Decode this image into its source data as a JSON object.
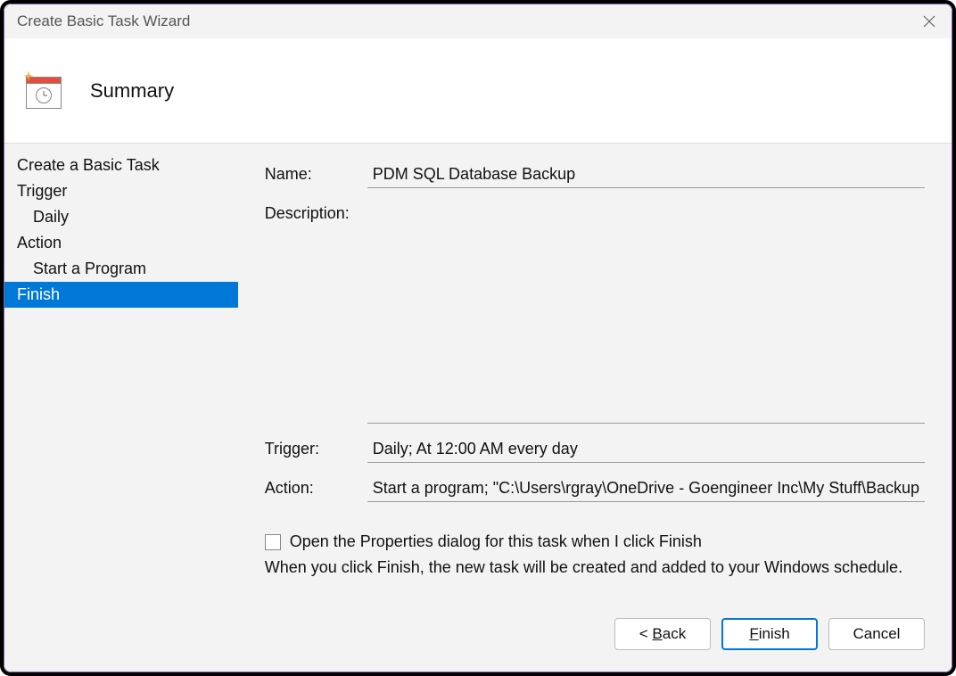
{
  "window": {
    "title": "Create Basic Task Wizard"
  },
  "header": {
    "title": "Summary"
  },
  "sidebar": {
    "items": [
      {
        "label": "Create a Basic Task",
        "sub": false,
        "selected": false
      },
      {
        "label": "Trigger",
        "sub": false,
        "selected": false
      },
      {
        "label": "Daily",
        "sub": true,
        "selected": false
      },
      {
        "label": "Action",
        "sub": false,
        "selected": false
      },
      {
        "label": "Start a Program",
        "sub": true,
        "selected": false
      },
      {
        "label": "Finish",
        "sub": false,
        "selected": true
      }
    ]
  },
  "form": {
    "name_label": "Name:",
    "name_value": "PDM SQL Database Backup",
    "description_label": "Description:",
    "description_value": "",
    "trigger_label": "Trigger:",
    "trigger_value": "Daily; At 12:00 AM every day",
    "action_label": "Action:",
    "action_value": "Start a program; \"C:\\Users\\rgray\\OneDrive - Goengineer Inc\\My Stuff\\Backup",
    "open_properties_label": "Open the Properties dialog for this task when I click Finish",
    "open_properties_checked": false,
    "hint": "When you click Finish, the new task will be created and added to your Windows schedule."
  },
  "buttons": {
    "back": "< Back",
    "finish": "Finish",
    "cancel": "Cancel"
  }
}
